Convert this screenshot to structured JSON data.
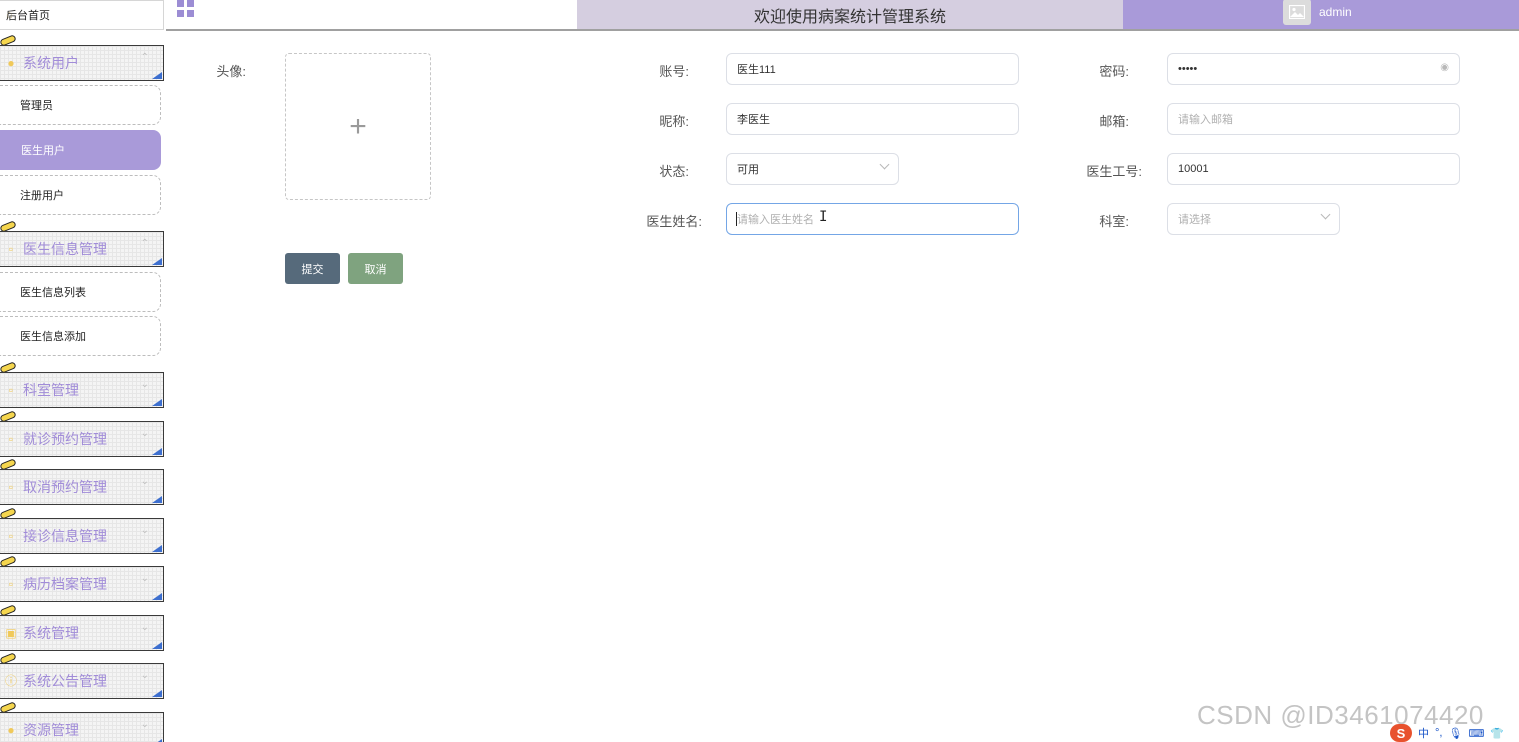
{
  "sidebar": {
    "home": {
      "label": "后台首页",
      "icon": "home-icon"
    },
    "groups": [
      {
        "label": "系统用户",
        "icon": "user-icon"
      },
      {
        "label": "医生信息管理",
        "icon": "document-icon"
      },
      {
        "label": "科室管理",
        "icon": "document-icon"
      },
      {
        "label": "就诊预约管理",
        "icon": "document-icon"
      },
      {
        "label": "取消预约管理",
        "icon": "document-icon"
      },
      {
        "label": "接诊信息管理",
        "icon": "document-icon"
      },
      {
        "label": "病历档案管理",
        "icon": "document-icon"
      },
      {
        "label": "系统管理",
        "icon": "picture-icon"
      },
      {
        "label": "系统公告管理",
        "icon": "info-icon"
      },
      {
        "label": "资源管理",
        "icon": "bulb-icon"
      }
    ],
    "sub_items": {
      "admin": "管理员",
      "doctor_user": "医生用户",
      "registered_user": "注册用户",
      "doctor_list": "医生信息列表",
      "doctor_add": "医生信息添加"
    },
    "active_item": "医生用户",
    "accent_color": "#a99ad9"
  },
  "header": {
    "title": "欢迎使用病案统计管理系统",
    "user": "admin",
    "grid_icon": "grid-menu-icon"
  },
  "form": {
    "avatar_label": "头像:",
    "account_label": "账号:",
    "account_value": "医生111",
    "password_label": "密码:",
    "password_value": "•••••",
    "nickname_label": "昵称:",
    "nickname_value": "李医生",
    "email_label": "邮箱:",
    "email_placeholder": "请输入邮箱",
    "status_label": "状态:",
    "status_value": "可用",
    "doctor_id_label": "医生工号:",
    "doctor_id_value": "10001",
    "doctor_name_label": "医生姓名:",
    "doctor_name_placeholder": "请输入医生姓名",
    "department_label": "科室:",
    "department_placeholder": "请选择",
    "submit_label": "提交",
    "cancel_label": "取消"
  },
  "watermark": "CSDN @ID3461074420",
  "ime": {
    "logo": "S",
    "mode": "中"
  }
}
